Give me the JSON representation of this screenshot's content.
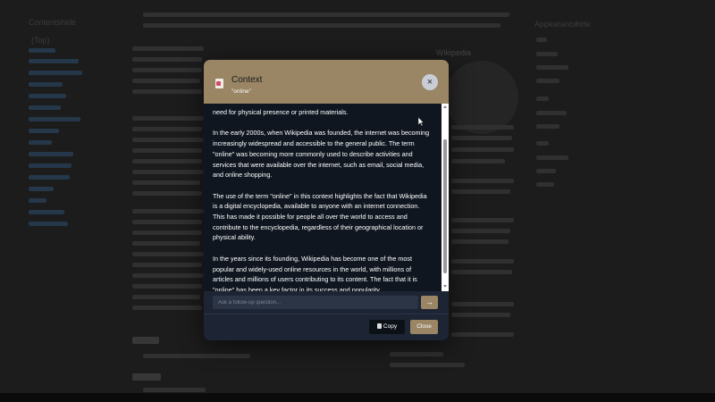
{
  "modal": {
    "title": "Context",
    "subtitle": "\"online\"",
    "close_glyph": "×",
    "paragraphs": [
      "need for physical presence or printed materials.",
      "In the early 2000s, when Wikipedia was founded, the internet was becoming increasingly widespread and accessible to the general public. The term \"online\" was becoming more commonly used to describe activities and services that were available over the internet, such as email, social media, and online shopping.",
      "The use of the term \"online\" in this context highlights the fact that Wikipedia is a digital encyclopedia, available to anyone with an internet connection. This has made it possible for people all over the world to access and contribute to the encyclopedia, regardless of their geographical location or physical ability.",
      "In the years since its founding, Wikipedia has become one of the most popular and widely-used online resources in the world, with millions of articles and millions of users contributing to its content. The fact that it is \"online\" has been a key factor in its success and popularity."
    ],
    "followup_placeholder": "Ask a follow-up question...",
    "send_glyph": "→",
    "copy_label": "Copy",
    "close_label": "Close"
  },
  "background": {
    "sidebar_heading": "Contents",
    "sidebar_hide": "hide",
    "top_item": "(Top)",
    "infobox_title": "Wikipedia",
    "appearance": "Appearance",
    "appearance_hide": "hide"
  },
  "colors": {
    "header": "#9a8565",
    "modal_body": "#0f1620",
    "modal_frame": "#1d2535"
  }
}
